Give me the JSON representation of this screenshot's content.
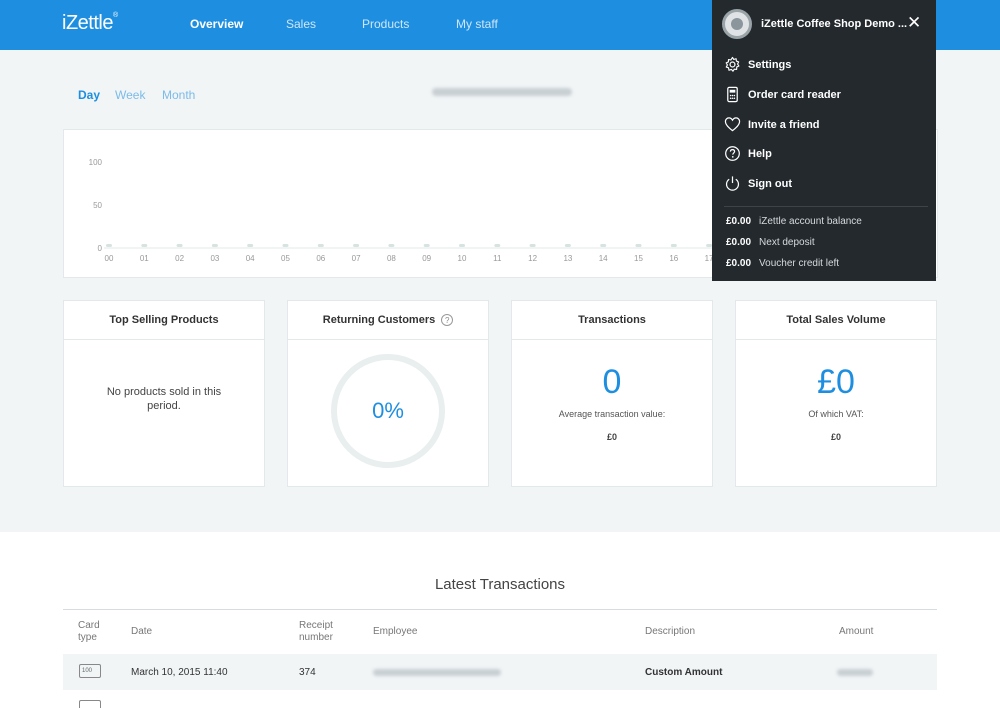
{
  "header": {
    "logo": "iZettle",
    "nav": [
      {
        "label": "Overview",
        "active": true
      },
      {
        "label": "Sales",
        "active": false
      },
      {
        "label": "Products",
        "active": false
      },
      {
        "label": "My staff",
        "active": false
      }
    ],
    "brand_color": "#1e8fe0"
  },
  "period_tabs": [
    {
      "label": "Day",
      "active": true
    },
    {
      "label": "Week",
      "active": false
    },
    {
      "label": "Month",
      "active": false
    }
  ],
  "chart_data": {
    "type": "line",
    "x": [
      "00",
      "01",
      "02",
      "03",
      "04",
      "05",
      "06",
      "07",
      "08",
      "09",
      "10",
      "11",
      "12",
      "13",
      "14",
      "15",
      "16",
      "17"
    ],
    "values": [
      0,
      0,
      0,
      0,
      0,
      0,
      0,
      0,
      0,
      0,
      0,
      0,
      0,
      0,
      0,
      0,
      0,
      0
    ],
    "yticks": [
      "100",
      "50",
      "0"
    ],
    "ylim": [
      0,
      100
    ]
  },
  "cards": {
    "top_selling": {
      "title": "Top Selling Products",
      "empty_text": "No products sold in this period."
    },
    "returning": {
      "title": "Returning Customers",
      "help_icon": "?",
      "value": "0%"
    },
    "transactions": {
      "title": "Transactions",
      "value": "0",
      "sub_label": "Average transaction value:",
      "sub_value": "£0"
    },
    "sales_volume": {
      "title": "Total Sales Volume",
      "value": "£0",
      "sub_label": "Of which VAT:",
      "sub_value": "£0"
    }
  },
  "latest": {
    "title": "Latest Transactions",
    "headers": [
      "Card type",
      "Date",
      "Receipt number",
      "Employee",
      "Description",
      "Amount"
    ],
    "rows": [
      {
        "card_icon": "100",
        "date": "March 10, 2015 11:40",
        "receipt": "374",
        "description": "Custom Amount"
      }
    ]
  },
  "menu": {
    "account_name": "iZettle Coffee Shop Demo ...",
    "items": [
      {
        "icon": "gear-icon",
        "label": "Settings"
      },
      {
        "icon": "card-reader-icon",
        "label": "Order card reader"
      },
      {
        "icon": "heart-icon",
        "label": "Invite a friend"
      },
      {
        "icon": "help-icon",
        "label": "Help"
      },
      {
        "icon": "power-icon",
        "label": "Sign out"
      }
    ],
    "balances": [
      {
        "amount": "£0.00",
        "label": "iZettle account balance"
      },
      {
        "amount": "£0.00",
        "label": "Next deposit"
      },
      {
        "amount": "£0.00",
        "label": "Voucher credit left"
      }
    ]
  }
}
